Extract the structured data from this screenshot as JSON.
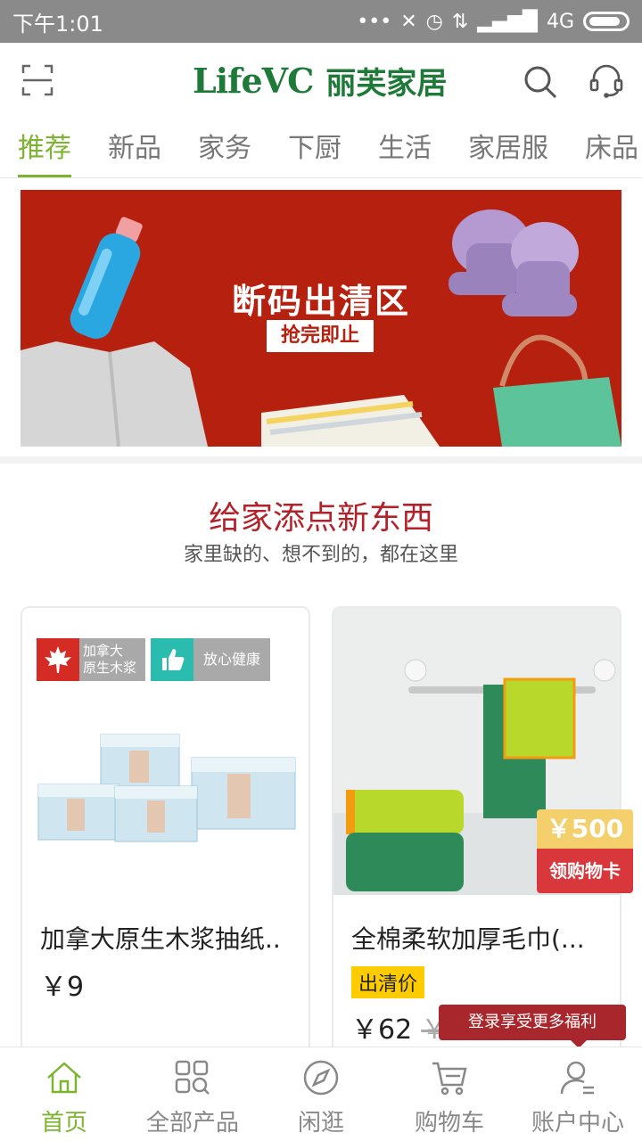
{
  "status_bar": {
    "time": "下午1:01",
    "network": "4G",
    "signal_icon": "signal-icon",
    "battery_icon": "battery-icon"
  },
  "header": {
    "logo_en": "LifeVC",
    "logo_cn": "丽芙家居",
    "scan_icon": "scan-icon",
    "search_icon": "search-icon",
    "service_icon": "customer-service-icon",
    "brand_color": "#1f7a3a"
  },
  "tabs": [
    {
      "label": "推荐",
      "active": true
    },
    {
      "label": "新品"
    },
    {
      "label": "家务"
    },
    {
      "label": "下厨"
    },
    {
      "label": "生活"
    },
    {
      "label": "家居服"
    },
    {
      "label": "床品"
    }
  ],
  "banner": {
    "title": "断码出清区",
    "tag": "抢完即止",
    "bg_color": "#b6200e"
  },
  "section": {
    "title": "给家添点新东西",
    "subtitle": "家里缺的、想不到的，都在这里"
  },
  "products": [
    {
      "name": "加拿大原生木浆抽纸..",
      "price": "￥9",
      "badges": [
        {
          "icon": "maple-leaf-icon",
          "text": "加拿大\n原生木浆"
        },
        {
          "icon": "thumbs-up-icon",
          "text": "放心健康"
        }
      ]
    },
    {
      "name": "全棉柔软加厚毛巾(...",
      "tag": "出清价",
      "price": "￥62",
      "old_price": "￥",
      "coupon": {
        "amount": "￥500",
        "label": "领购物卡"
      }
    }
  ],
  "login_tip": "登录享受更多福利",
  "bottom_nav": [
    {
      "label": "首页",
      "icon": "home-icon",
      "active": true
    },
    {
      "label": "全部产品",
      "icon": "grid-search-icon"
    },
    {
      "label": "闲逛",
      "icon": "compass-icon"
    },
    {
      "label": "购物车",
      "icon": "cart-icon"
    },
    {
      "label": "账户中心",
      "icon": "user-icon"
    }
  ],
  "accent_color": "#7cb32f"
}
